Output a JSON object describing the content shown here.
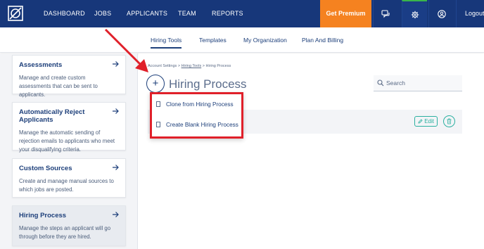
{
  "topnav": {
    "links": [
      "DASHBOARD",
      "JOBS",
      "APPLICANTS",
      "TEAM",
      "REPORTS"
    ],
    "premium": "Get Premium",
    "logout": "Logout",
    "icons": [
      "chat-icon",
      "gear-icon",
      "user-icon"
    ]
  },
  "subnav": {
    "tabs": [
      "Hiring Tools",
      "Templates",
      "My Organization",
      "Plan And Billing"
    ],
    "active": "Hiring Tools"
  },
  "sidebar": {
    "cards": [
      {
        "title": "Assessments",
        "desc": "Manage and create custom assessments that can be sent to applicants."
      },
      {
        "title": "Automatically Reject Applicants",
        "desc": "Manage the automatic sending of rejection emails to applicants who meet your disqualifying criteria."
      },
      {
        "title": "Custom Sources",
        "desc": "Create and manage manual sources to which jobs are posted."
      },
      {
        "title": "Hiring Process",
        "desc": "Manage the steps an applicant will go through before they are hired."
      }
    ]
  },
  "main": {
    "breadcrumb": {
      "a": "Account Settings",
      "sep": ">",
      "b": "Hiring Tools",
      "c": "Hiring Process"
    },
    "add_label": "+",
    "title": "Hiring Process",
    "search_placeholder": "Search",
    "edit_label": "Edit"
  },
  "dropdown": {
    "items": [
      "Clone from Hiring Process",
      "Create Blank Hiring Process"
    ]
  },
  "colors": {
    "nav": "#17377a",
    "premium": "#f58220",
    "accent": "#2bb0a0",
    "highlight": "#e0202a"
  }
}
